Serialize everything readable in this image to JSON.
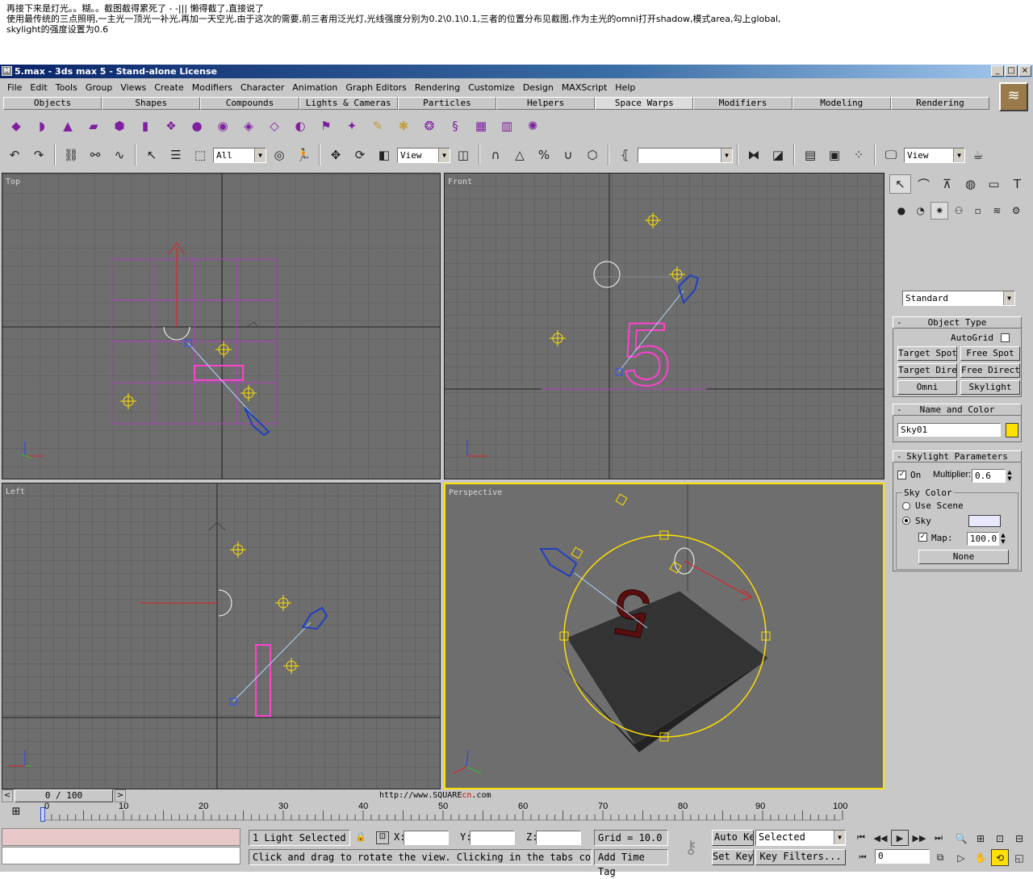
{
  "post": {
    "line1": "再接下来是灯光。。糊。。截图截得累死了 - -||| 懒得截了,直接说了",
    "line2": "使用最传统的三点照明,一主光一顶光一补光,再加一天空光,由于这次的需要,前三者用泛光灯,光线强度分别为0.2\\0.1\\0.1,三者的位置分布见截图,作为主光的omni打开shadow,模式area,勾上global,",
    "line3": "skylight的强度设置为0.6"
  },
  "window": {
    "title": "5.max - 3ds max 5 - Stand-alone License",
    "app_icon": "max-icon",
    "controls": [
      "_",
      "□",
      "×"
    ]
  },
  "menu": [
    "File",
    "Edit",
    "Tools",
    "Group",
    "Views",
    "Create",
    "Modifiers",
    "Character",
    "Animation",
    "Graph Editors",
    "Rendering",
    "Customize",
    "Design",
    "MAXScript",
    "Help"
  ],
  "tabs": [
    "Objects",
    "Shapes",
    "Compounds",
    "Lights & Cameras",
    "Particles",
    "Helpers",
    "Space Warps",
    "Modifiers",
    "Modeling",
    "Rendering"
  ],
  "active_tab": "Space Warps",
  "toolbar": {
    "selection_filter": "All",
    "ref_coord": "View",
    "named_selection": "",
    "render_type": "View"
  },
  "viewports": {
    "top": "Top",
    "front": "Front",
    "left": "Left",
    "perspective": "Perspective"
  },
  "command_panel": {
    "category": "Standard",
    "object_type": {
      "title": "Object Type",
      "autogrid": "AutoGrid",
      "buttons": [
        "Target Spot",
        "Free Spot",
        "Target Direct",
        "Free Direct",
        "Omni",
        "Skylight"
      ]
    },
    "name_color": {
      "title": "Name and Color",
      "name": "Sky01",
      "color": "#ffe000"
    },
    "skylight": {
      "title": "Skylight Parameters",
      "on_label": "On",
      "multiplier_label": "Multiplier:",
      "multiplier": "0.6",
      "sky_color_label": "Sky Color",
      "use_scene_label": "Use Scene",
      "sky_label": "Sky",
      "sky_swatch": "#e8e8ff",
      "map_label": "Map:",
      "map_value": "100.0",
      "map_button": "None"
    }
  },
  "timeline": {
    "slider": "0 / 100",
    "ticks": [
      "0",
      "10",
      "20",
      "30",
      "40",
      "50",
      "60",
      "70",
      "80",
      "90",
      "100"
    ],
    "watermark_prefix": "http://www.SQUARE",
    "watermark_accent": "cn",
    "watermark_suffix": ".com"
  },
  "status": {
    "selection": "1 Light Selected",
    "prompt": "Click and drag to rotate the view.  Clicking in the tabs con",
    "x_label": "X:",
    "y_label": "Y:",
    "z_label": "Z:",
    "grid": "Grid = 10.0",
    "add_time_tag": "Add Time Tag",
    "auto_key": "Auto Key",
    "set_key": "Set Key",
    "key_mode": "Selected",
    "key_filters": "Key Filters...",
    "frame": "0"
  },
  "colors": {
    "viewport_bg": "#6e6e6e",
    "grid_line": "#5a5a5a",
    "active_border": "#ffe000",
    "light_yellow": "#ffe000",
    "object_magenta": "#e040c0",
    "camera_blue": "#2040c0"
  }
}
